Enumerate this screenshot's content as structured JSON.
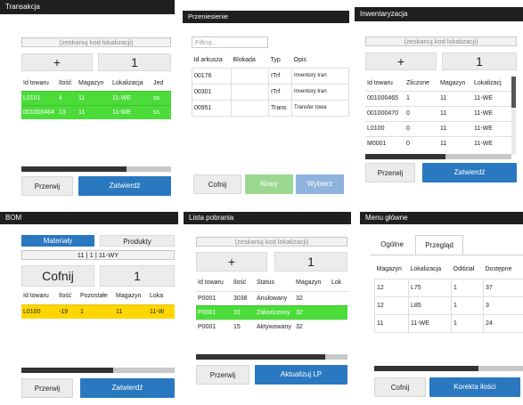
{
  "transakcja": {
    "title": "Transakcja",
    "scan_placeholder": "(zeskanuj kod lokalizacji)",
    "plus": "+",
    "qty": "1",
    "columns": [
      "Id towaru",
      "Ilość",
      "Magazyn",
      "Lokalizacja",
      "Jed"
    ],
    "rows": [
      [
        "L0101",
        "4",
        "11",
        "11-WE",
        "ss"
      ],
      [
        "001000464",
        "13",
        "11",
        "11-WE",
        "ss"
      ]
    ],
    "progress": 0.7,
    "cancel": "Przerwij",
    "confirm": "Zatwierdź"
  },
  "przeniesienie": {
    "title": "Przeniesienie",
    "filter_placeholder": "Filtruj...",
    "columns": [
      "Id arkusza",
      "Blokada",
      "Typ",
      "Opis"
    ],
    "rows": [
      [
        "00176",
        "",
        "ITrf",
        "Inventory tran"
      ],
      [
        "00301",
        "",
        "ITrf",
        "Inventory tran"
      ],
      [
        "00951",
        "",
        "Trans",
        "Transfer towa"
      ]
    ],
    "back": "Cofnij",
    "new": "Nowy",
    "choose": "Wybierz"
  },
  "inwentaryzacja": {
    "title": "Inwentaryzacja",
    "scan_placeholder": "(zeskanuj kod lokalizacji)",
    "plus": "+",
    "qty": "1",
    "columns": [
      "Id towaru",
      "Zliczone",
      "Magazyn",
      "Lokalizacj"
    ],
    "rows": [
      [
        "001000465",
        "1",
        "11",
        "11-WE"
      ],
      [
        "001000470",
        "0",
        "11",
        "11-WE"
      ],
      [
        "L0100",
        "0",
        "11",
        "11-WE"
      ],
      [
        "M0001",
        "0",
        "11",
        "11-WE"
      ]
    ],
    "progress": 0.55,
    "cancel": "Przerwij",
    "confirm": "Zatwierdź"
  },
  "bom": {
    "title": "BOM",
    "tab_materials": "Materiały",
    "tab_products": "Produkty",
    "location": "11 | 1 | 11-WY",
    "back": "Cofnij",
    "qty": "1",
    "columns": [
      "Id towaru",
      "Ilość",
      "Pozostałe",
      "Magazyn",
      "Loka"
    ],
    "rows": [
      [
        "L0100",
        "-19",
        "1",
        "11",
        "11-W"
      ]
    ],
    "progress": 0.6,
    "cancel": "Przerwij",
    "confirm": "Zatwierdź"
  },
  "lista": {
    "title": "Lista pobrania",
    "scan_placeholder": "(zeskanuj kod lokalizacji)",
    "plus": "+",
    "qty": "1",
    "columns": [
      "Id towaru",
      "Ilość",
      "Status",
      "Magazyn",
      "Lok"
    ],
    "rows": [
      [
        "P0001",
        "3038",
        "Anulowany",
        "32",
        ""
      ],
      [
        "P0001",
        "10",
        "Zakończony",
        "32",
        ""
      ],
      [
        "P0001",
        "15",
        "Aktywowany",
        "32",
        ""
      ]
    ],
    "progress": 0.85,
    "cancel": "Przerwij",
    "update": "Aktualizuj LP"
  },
  "menu": {
    "title": "Menu główne",
    "tab_general": "Ogólne",
    "tab_review": "Przegląd",
    "columns": [
      "Magazyn",
      "Lokalizacja",
      "Oddział",
      "Dostępne"
    ],
    "rows": [
      [
        "12",
        "L75",
        "1",
        "37"
      ],
      [
        "12",
        "L85",
        "1",
        "3"
      ],
      [
        "11",
        "11-WE",
        "1",
        "24"
      ]
    ],
    "progress": 0.7,
    "back": "Cofnij",
    "correct": "Korekta ilości"
  }
}
